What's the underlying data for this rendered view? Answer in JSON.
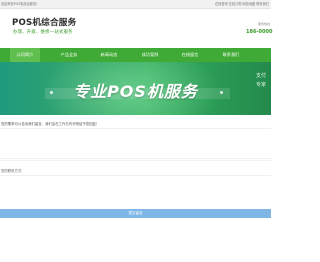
{
  "topbar": {
    "left_text": "欢迎来到POS机综合服务！",
    "links": [
      "在线咨询",
      "在线订购",
      "网站地图",
      "联系我们"
    ]
  },
  "header": {
    "title": "POS机综合服务",
    "slogan": "办理、升级、维修一站式服务",
    "hotline_label": "服务热线",
    "hotline_number": "186-0000"
  },
  "nav": {
    "items": [
      "公司简介",
      "产品业务",
      "新闻动态",
      "成功案例",
      "在线留言",
      "联系我们"
    ]
  },
  "banner": {
    "headline": "专业POS机服务",
    "side_text": [
      "支付",
      "专家"
    ]
  },
  "form": {
    "notice": "您的需求可以告诉我们留言，我们会在工作日内尽快给予您回复！",
    "contact_label": "您的联系方式",
    "submit_label": "提交留言"
  },
  "colors": {
    "nav_bg": "#3faa35",
    "accent_green": "#3a9a2a",
    "submit_bg": "#7fb6e6"
  }
}
